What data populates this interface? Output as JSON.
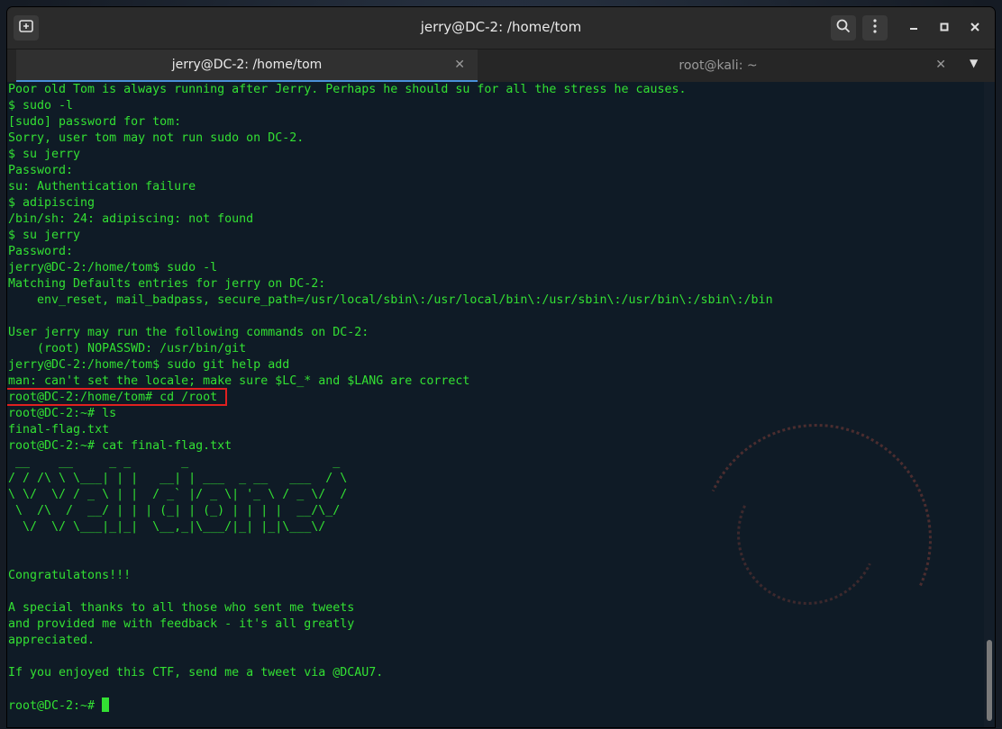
{
  "window": {
    "title": "jerry@DC-2: /home/tom"
  },
  "tabs": [
    {
      "label": "jerry@DC-2: /home/tom",
      "active": true
    },
    {
      "label": "root@kali: ~",
      "active": false
    }
  ],
  "icons": {
    "new_tab": "new-tab-icon",
    "search": "search-icon",
    "menu": "kebab-menu-icon",
    "minimize": "minimize-icon",
    "maximize": "maximize-icon",
    "close": "close-icon"
  },
  "colors": {
    "terminal_text": "#33e033",
    "highlight": "#e02020"
  },
  "terminal": {
    "lines": [
      "Poor old Tom is always running after Jerry. Perhaps he should su for all the stress he causes.",
      "$ sudo -l",
      "[sudo] password for tom:",
      "Sorry, user tom may not run sudo on DC-2.",
      "$ su jerry",
      "Password:",
      "su: Authentication failure",
      "$ adipiscing",
      "/bin/sh: 24: adipiscing: not found",
      "$ su jerry",
      "Password:",
      "jerry@DC-2:/home/tom$ sudo -l",
      "Matching Defaults entries for jerry on DC-2:",
      "    env_reset, mail_badpass, secure_path=/usr/local/sbin\\:/usr/local/bin\\:/usr/sbin\\:/usr/bin\\:/sbin\\:/bin",
      "",
      "User jerry may run the following commands on DC-2:",
      "    (root) NOPASSWD: /usr/bin/git",
      "jerry@DC-2:/home/tom$ sudo git help add",
      "man: can't set the locale; make sure $LC_* and $LANG are correct",
      "root@DC-2:/home/tom# cd /root",
      "root@DC-2:~# ls",
      "final-flag.txt",
      "root@DC-2:~# cat final-flag.txt",
      " __    __     _ _       _                    _ ",
      "/ / /\\ \\ \\___| | |   __| | ___  _ __   ___  / \\",
      "\\ \\/  \\/ / _ \\ | |  / _` |/ _ \\| '_ \\ / _ \\/  /",
      " \\  /\\  /  __/ | | | (_| | (_) | | | |  __/\\_/ ",
      "  \\/  \\/ \\___|_|_|  \\__,_|\\___/|_| |_|\\___\\/   ",
      "",
      "",
      "Congratulatons!!!",
      "",
      "A special thanks to all those who sent me tweets",
      "and provided me with feedback - it's all greatly",
      "appreciated.",
      "",
      "If you enjoyed this CTF, send me a tweet via @DCAU7.",
      "",
      "root@DC-2:~# "
    ]
  }
}
